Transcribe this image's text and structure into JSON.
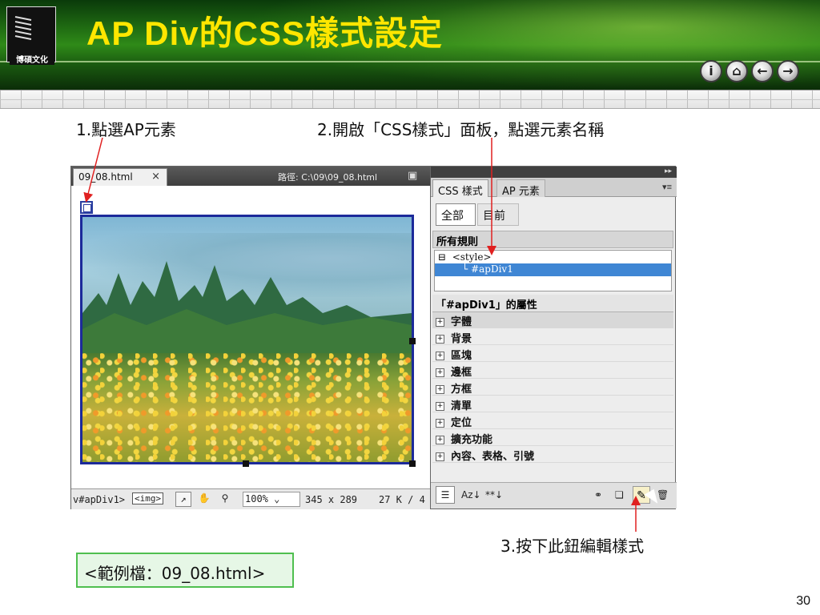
{
  "slide": {
    "title": "AP Div的CSS樣式設定",
    "logo_text": "博碩文化",
    "nav_buttons": [
      "i",
      "⌂",
      "←",
      "→"
    ],
    "page_number": "30",
    "accent_color": "#ffe600",
    "header_color": "#1f6a12"
  },
  "callouts": {
    "step1": "1.點選AP元素",
    "step2": "2.開啟「CSS樣式」面板，點選元素名稱",
    "step3": "3.按下此鈕編輯樣式",
    "arrow_color": "#e02020"
  },
  "doc_window": {
    "tab_label": "09_08.html",
    "close_label": "×",
    "path_text": "路徑: C:\\09\\09_08.html",
    "status": {
      "tag_path": "v#apDiv1>",
      "tag_img": "<img>",
      "zoom": "100%",
      "size": "345 x 289",
      "kb": "27 K / 4"
    }
  },
  "css_panel": {
    "tabs": [
      "CSS 樣式",
      "AP 元素"
    ],
    "mode_buttons": [
      "全部",
      "目前"
    ],
    "all_rules_header": "所有規則",
    "rules": [
      "<style>",
      "#apDiv1"
    ],
    "properties_header": "「#apDiv1」的屬性",
    "categories": [
      "字體",
      "背景",
      "區塊",
      "邊框",
      "方框",
      "清單",
      "定位",
      "擴充功能",
      "內容、表格、引號"
    ],
    "toolbar": [
      "Az↓",
      "**↓"
    ]
  },
  "example_file": "<範例檔：09_08.html>"
}
